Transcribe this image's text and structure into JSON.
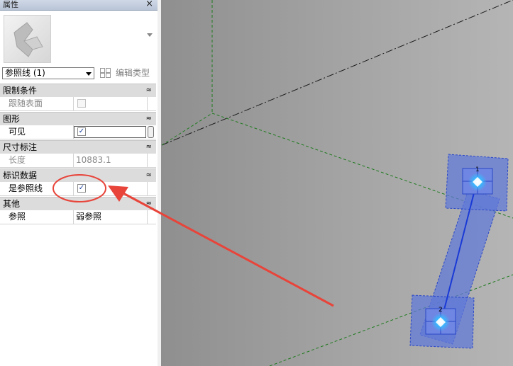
{
  "panel": {
    "title": "属性",
    "close": "×",
    "selector_value": "参照线 (1)",
    "edit_type_label": "编辑类型",
    "collapse_glyph": "≈"
  },
  "groups": {
    "constraints": "限制条件",
    "graphics": "图形",
    "dimensions": "尺寸标注",
    "identity": "标识数据",
    "other": "其他"
  },
  "rows": {
    "follow_surface": {
      "label": "跟随表面",
      "checked": false
    },
    "visible": {
      "label": "可见",
      "checked": true
    },
    "length": {
      "label": "长度",
      "value": "10883.1"
    },
    "is_reference_line": {
      "label": "是参照线",
      "checked": true
    },
    "reference": {
      "label": "参照",
      "value": "弱参照"
    }
  },
  "viewport": {
    "endpoint_labels": [
      "1",
      "2"
    ],
    "colors": {
      "selection_fill": "#5f78d8",
      "selection_edge": "#2a47c6",
      "grid_green": "#1e7a1e",
      "annotation_red": "#e8443a"
    }
  },
  "checkmark": "✓"
}
